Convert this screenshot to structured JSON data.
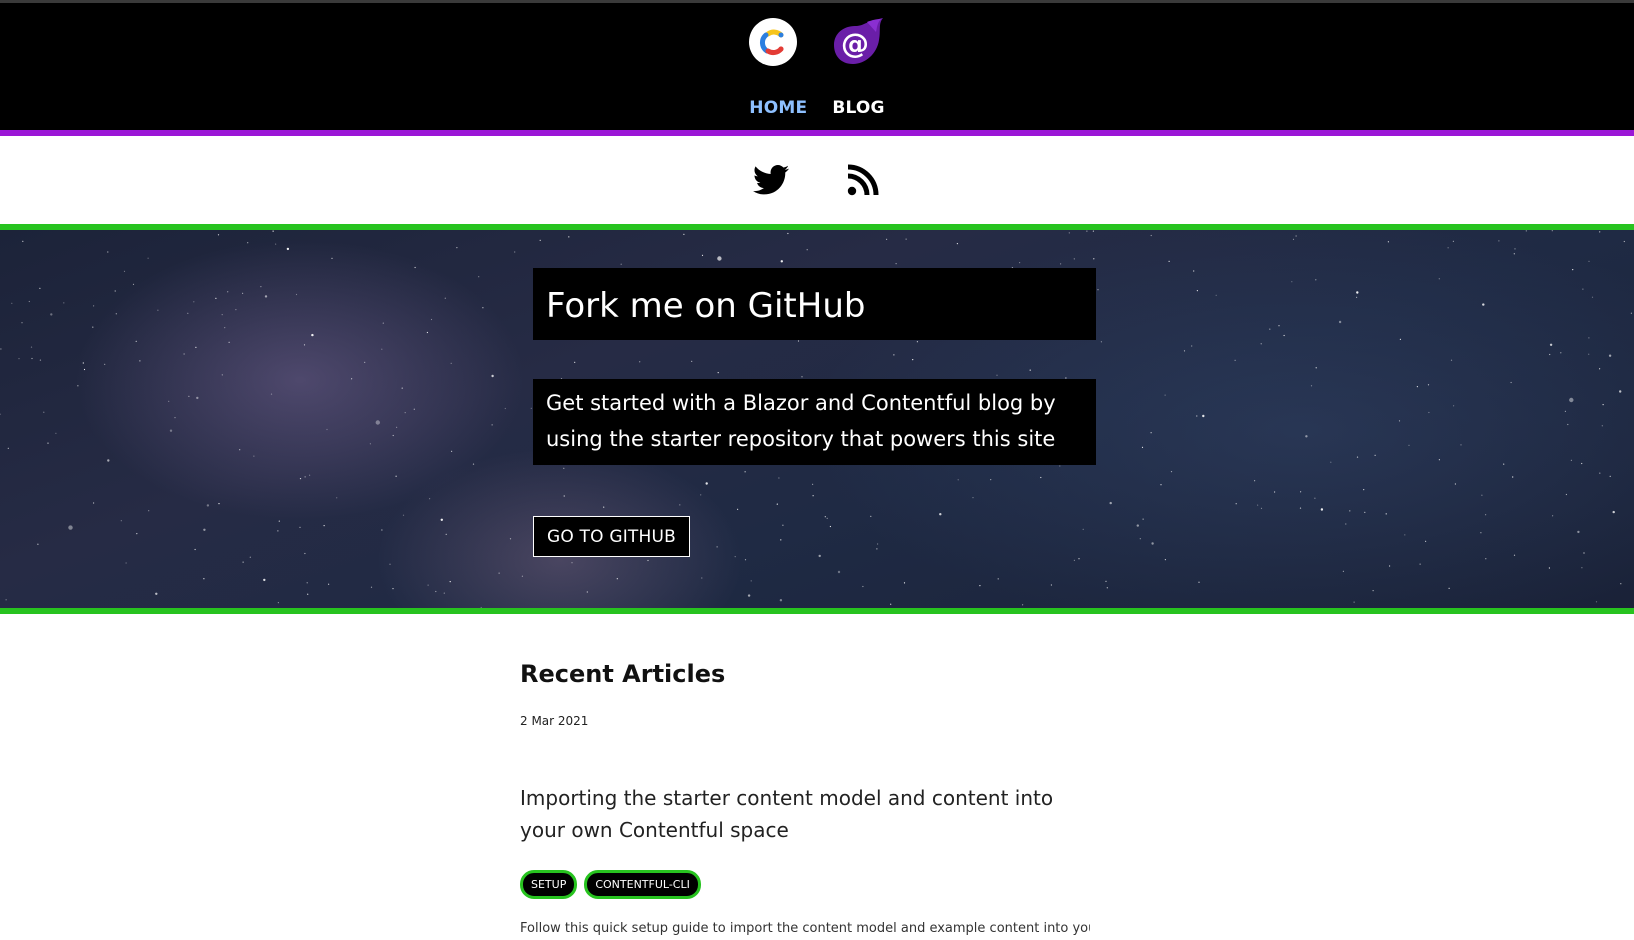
{
  "header": {
    "logos": [
      "contentful-logo",
      "blazor-logo"
    ],
    "nav": [
      {
        "label": "HOME",
        "active": true
      },
      {
        "label": "BLOG",
        "active": false
      }
    ],
    "accent_color": "#9b16d6"
  },
  "social": {
    "icons": [
      "twitter-icon",
      "rss-icon"
    ],
    "accent_color": "#27c31f"
  },
  "hero": {
    "title": "Fork me on GitHub",
    "description": "Get started with a Blazor and Contentful blog by using the starter repository that powers this site",
    "button_label": "GO TO GITHUB"
  },
  "articles": {
    "section_title": "Recent Articles",
    "items": [
      {
        "date": "2 Mar 2021",
        "title": "Importing the starter content model and content into your own Contentful space",
        "tags": [
          "SETUP",
          "CONTENTFUL-CLI"
        ],
        "excerpt": "Follow this quick setup guide to import the content model and example content into your"
      }
    ]
  }
}
